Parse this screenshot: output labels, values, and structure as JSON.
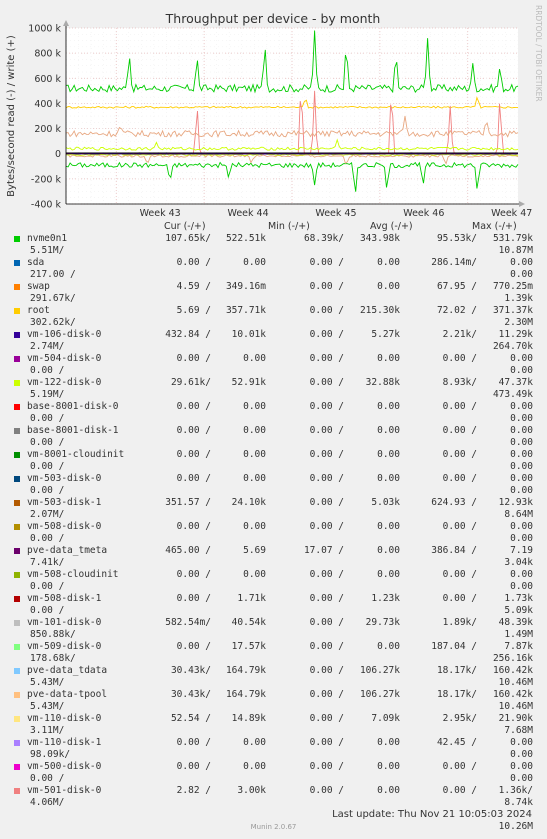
{
  "chart_data": {
    "type": "line",
    "title": "Throughput per device - by month",
    "ylabel": "Bytes/second read (-) / write (+)",
    "ylim": [
      -400000,
      1000000
    ],
    "yticks": [
      {
        "v": 1000000,
        "label": "1000 k"
      },
      {
        "v": 800000,
        "label": "800 k"
      },
      {
        "v": 600000,
        "label": "600 k"
      },
      {
        "v": 400000,
        "label": "400 k"
      },
      {
        "v": 200000,
        "label": "200 k"
      },
      {
        "v": 0,
        "label": "0"
      },
      {
        "v": -200000,
        "label": "-200 k"
      },
      {
        "v": -400000,
        "label": "-400 k"
      }
    ],
    "xlabels": [
      "Week 43",
      "Week 44",
      "Week 45",
      "Week 46",
      "Week 47"
    ],
    "grid": true,
    "series": [
      {
        "name": "nvme0n1",
        "color": "#00cc00",
        "write_base": 520000,
        "write_noise": 30000,
        "write_spikes": [
          [
            0.14,
            800000
          ],
          [
            0.29,
            780000
          ],
          [
            0.44,
            880000
          ],
          [
            0.55,
            980000
          ],
          [
            0.62,
            900000
          ],
          [
            0.73,
            820000
          ],
          [
            0.8,
            920000
          ],
          [
            0.9,
            720000
          ],
          [
            0.96,
            700000
          ]
        ],
        "read_base": -90000,
        "read_noise": 20000,
        "read_spikes": [
          [
            0.23,
            -230000
          ],
          [
            0.36,
            -200000
          ],
          [
            0.55,
            -250000
          ],
          [
            0.64,
            -340000
          ],
          [
            0.71,
            -300000
          ],
          [
            0.79,
            -260000
          ],
          [
            0.91,
            -310000
          ]
        ]
      },
      {
        "name": "root",
        "color": "#ffcc00",
        "write_base": 370000,
        "write_noise": 8000,
        "write_spikes": [
          [
            0.53,
            450000
          ],
          [
            0.91,
            460000
          ]
        ],
        "read_base": 0,
        "read_noise": 0,
        "read_spikes": []
      },
      {
        "name": "vm-501-disk-0",
        "color": "#f08080",
        "write_base": 0,
        "write_noise": 0,
        "write_spikes": [
          [
            0.29,
            400000
          ],
          [
            0.52,
            600000
          ],
          [
            0.55,
            500000
          ],
          [
            0.72,
            560000
          ],
          [
            0.85,
            380000
          ],
          [
            0.96,
            470000
          ]
        ],
        "read_base": 0,
        "read_noise": 0,
        "read_spikes": []
      },
      {
        "name": "pve-data-tpool",
        "color": "#e8a882",
        "write_base": 160000,
        "write_noise": 25000,
        "write_spikes": [
          [
            0.12,
            230000
          ],
          [
            0.75,
            300000
          ],
          [
            0.93,
            280000
          ]
        ],
        "read_base": -18000,
        "read_noise": 10000,
        "read_spikes": [
          [
            0.18,
            -90000
          ],
          [
            0.41,
            -80000
          ],
          [
            0.62,
            -100000
          ],
          [
            0.84,
            -90000
          ]
        ]
      },
      {
        "name": "vm-122-disk-0",
        "color": "#ccff00",
        "write_base": 40000,
        "write_noise": 12000,
        "write_spikes": [
          [
            0.2,
            90000
          ],
          [
            0.6,
            110000
          ]
        ],
        "read_base": -8000,
        "read_noise": 5000,
        "read_spikes": []
      },
      {
        "name": "vm-106-disk-0",
        "color": "#330099",
        "write_base": 3000,
        "write_noise": 2000,
        "write_spikes": [],
        "read_base": -2000,
        "read_noise": 1500,
        "read_spikes": []
      },
      {
        "name": "pve-data_tmeta",
        "color": "#660066",
        "write_base": 4000,
        "write_noise": 3000,
        "write_spikes": [],
        "read_base": 0,
        "read_noise": 0,
        "read_spikes": []
      }
    ]
  },
  "legend": {
    "headers": {
      "cur": "Cur (-/+)",
      "min": "Min (-/+)",
      "avg": "Avg (-/+)",
      "max": "Max (-/+)"
    },
    "rows": [
      {
        "color": "#00cc00",
        "name": "nvme0n1",
        "cur_r": "107.65k/",
        "cur_w": "522.51k",
        "min_r": "68.39k/",
        "min_w": "343.98k",
        "avg_r": "95.53k/",
        "avg_w": "531.79k",
        "max_r": "5.51M/",
        "max_w": "10.87M"
      },
      {
        "color": "#0066b3",
        "name": "sda",
        "cur_r": "0.00 /",
        "cur_w": "0.00",
        "min_r": "0.00 /",
        "min_w": "0.00",
        "avg_r": "286.14m/",
        "avg_w": "0.00",
        "max_r": "217.00 /",
        "max_w": "0.00"
      },
      {
        "color": "#ff8000",
        "name": "swap",
        "cur_r": "4.59 /",
        "cur_w": "349.16m",
        "min_r": "0.00 /",
        "min_w": "0.00",
        "avg_r": "67.95 /",
        "avg_w": "770.25m",
        "max_r": "291.67k/",
        "max_w": "1.39k"
      },
      {
        "color": "#ffcc00",
        "name": "root",
        "cur_r": "5.69 /",
        "cur_w": "357.71k",
        "min_r": "0.00 /",
        "min_w": "215.30k",
        "avg_r": "72.02 /",
        "avg_w": "371.37k",
        "max_r": "302.62k/",
        "max_w": "2.30M"
      },
      {
        "color": "#330099",
        "name": "vm-106-disk-0",
        "cur_r": "432.84 /",
        "cur_w": "10.01k",
        "min_r": "0.00 /",
        "min_w": "5.27k",
        "avg_r": "2.21k/",
        "avg_w": "11.29k",
        "max_r": "2.74M/",
        "max_w": "264.70k"
      },
      {
        "color": "#990099",
        "name": "vm-504-disk-0",
        "cur_r": "0.00 /",
        "cur_w": "0.00",
        "min_r": "0.00 /",
        "min_w": "0.00",
        "avg_r": "0.00 /",
        "avg_w": "0.00",
        "max_r": "0.00 /",
        "max_w": "0.00"
      },
      {
        "color": "#ccff00",
        "name": "vm-122-disk-0",
        "cur_r": "29.61k/",
        "cur_w": "52.91k",
        "min_r": "0.00 /",
        "min_w": "32.88k",
        "avg_r": "8.93k/",
        "avg_w": "47.37k",
        "max_r": "5.19M/",
        "max_w": "473.49k"
      },
      {
        "color": "#ff0000",
        "name": "base-8001-disk-0",
        "cur_r": "0.00 /",
        "cur_w": "0.00",
        "min_r": "0.00 /",
        "min_w": "0.00",
        "avg_r": "0.00 /",
        "avg_w": "0.00",
        "max_r": "0.00 /",
        "max_w": "0.00"
      },
      {
        "color": "#808080",
        "name": "base-8001-disk-1",
        "cur_r": "0.00 /",
        "cur_w": "0.00",
        "min_r": "0.00 /",
        "min_w": "0.00",
        "avg_r": "0.00 /",
        "avg_w": "0.00",
        "max_r": "0.00 /",
        "max_w": "0.00"
      },
      {
        "color": "#008f00",
        "name": "vm-8001-cloudinit",
        "cur_r": "0.00 /",
        "cur_w": "0.00",
        "min_r": "0.00 /",
        "min_w": "0.00",
        "avg_r": "0.00 /",
        "avg_w": "0.00",
        "max_r": "0.00 /",
        "max_w": "0.00"
      },
      {
        "color": "#00487d",
        "name": "vm-503-disk-0",
        "cur_r": "0.00 /",
        "cur_w": "0.00",
        "min_r": "0.00 /",
        "min_w": "0.00",
        "avg_r": "0.00 /",
        "avg_w": "0.00",
        "max_r": "0.00 /",
        "max_w": "0.00"
      },
      {
        "color": "#b35a00",
        "name": "vm-503-disk-1",
        "cur_r": "351.57 /",
        "cur_w": "24.10k",
        "min_r": "0.00 /",
        "min_w": "5.03k",
        "avg_r": "624.93 /",
        "avg_w": "12.93k",
        "max_r": "2.07M/",
        "max_w": "8.64M"
      },
      {
        "color": "#b38f00",
        "name": "vm-508-disk-0",
        "cur_r": "0.00 /",
        "cur_w": "0.00",
        "min_r": "0.00 /",
        "min_w": "0.00",
        "avg_r": "0.00 /",
        "avg_w": "0.00",
        "max_r": "0.00 /",
        "max_w": "0.00"
      },
      {
        "color": "#6b006b",
        "name": "pve-data_tmeta",
        "cur_r": "465.00 /",
        "cur_w": "5.69",
        "min_r": "17.07 /",
        "min_w": "0.00",
        "avg_r": "386.84 /",
        "avg_w": "7.19",
        "max_r": "7.41k/",
        "max_w": "3.04k"
      },
      {
        "color": "#8fb300",
        "name": "vm-508-cloudinit",
        "cur_r": "0.00 /",
        "cur_w": "0.00",
        "min_r": "0.00 /",
        "min_w": "0.00",
        "avg_r": "0.00 /",
        "avg_w": "0.00",
        "max_r": "0.00 /",
        "max_w": "0.00"
      },
      {
        "color": "#b30000",
        "name": "vm-508-disk-1",
        "cur_r": "0.00 /",
        "cur_w": "1.71k",
        "min_r": "0.00 /",
        "min_w": "1.23k",
        "avg_r": "0.00 /",
        "avg_w": "1.73k",
        "max_r": "0.00 /",
        "max_w": "5.09k"
      },
      {
        "color": "#bebebe",
        "name": "vm-101-disk-0",
        "cur_r": "582.54m/",
        "cur_w": "40.54k",
        "min_r": "0.00 /",
        "min_w": "29.73k",
        "avg_r": "1.89k/",
        "avg_w": "48.39k",
        "max_r": "850.88k/",
        "max_w": "1.49M"
      },
      {
        "color": "#80ff80",
        "name": "vm-509-disk-0",
        "cur_r": "0.00 /",
        "cur_w": "17.57k",
        "min_r": "0.00 /",
        "min_w": "0.00",
        "avg_r": "187.04 /",
        "avg_w": "7.87k",
        "max_r": "178.68k/",
        "max_w": "256.16k"
      },
      {
        "color": "#80c9ff",
        "name": "pve-data_tdata",
        "cur_r": "30.43k/",
        "cur_w": "164.79k",
        "min_r": "0.00 /",
        "min_w": "106.27k",
        "avg_r": "18.17k/",
        "avg_w": "160.42k",
        "max_r": "5.43M/",
        "max_w": "10.46M"
      },
      {
        "color": "#ffc080",
        "name": "pve-data-tpool",
        "cur_r": "30.43k/",
        "cur_w": "164.79k",
        "min_r": "0.00 /",
        "min_w": "106.27k",
        "avg_r": "18.17k/",
        "avg_w": "160.42k",
        "max_r": "5.43M/",
        "max_w": "10.46M"
      },
      {
        "color": "#ffe680",
        "name": "vm-110-disk-0",
        "cur_r": "52.54 /",
        "cur_w": "14.89k",
        "min_r": "0.00 /",
        "min_w": "7.09k",
        "avg_r": "2.95k/",
        "avg_w": "21.90k",
        "max_r": "3.11M/",
        "max_w": "7.68M"
      },
      {
        "color": "#aa80ff",
        "name": "vm-110-disk-1",
        "cur_r": "0.00 /",
        "cur_w": "0.00",
        "min_r": "0.00 /",
        "min_w": "0.00",
        "avg_r": "42.45 /",
        "avg_w": "0.00",
        "max_r": "98.09k/",
        "max_w": "0.00"
      },
      {
        "color": "#ee00cc",
        "name": "vm-500-disk-0",
        "cur_r": "0.00 /",
        "cur_w": "0.00",
        "min_r": "0.00 /",
        "min_w": "0.00",
        "avg_r": "0.00 /",
        "avg_w": "0.00",
        "max_r": "0.00 /",
        "max_w": "0.00"
      },
      {
        "color": "#f08080",
        "name": "vm-501-disk-0",
        "cur_r": "2.82 /",
        "cur_w": "3.00k",
        "min_r": "0.00 /",
        "min_w": "0.00",
        "avg_r": "0.00 /",
        "avg_w": "1.36k/",
        "max_r": "4.06M/",
        "max_w": "8.74k"
      },
      {
        "color": "#f08080",
        "name": "",
        "cur_r": "",
        "cur_w": "",
        "min_r": "",
        "min_w": "",
        "avg_r": "",
        "avg_w": "",
        "max_r": "",
        "max_w": "10.26M"
      }
    ]
  },
  "footer": {
    "last_update": "Last update: Thu Nov 21 10:05:03 2024",
    "munin": "Munin 2.0.67"
  },
  "side_label": "RRDTOOL / TOBI OETIKER"
}
